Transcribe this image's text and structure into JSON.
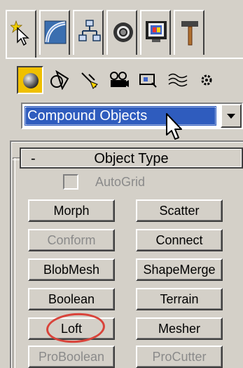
{
  "command_tabs": [
    {
      "icon": "create-star-cursor-icon",
      "active": true
    },
    {
      "icon": "modify-bend-icon",
      "active": false
    },
    {
      "icon": "hierarchy-icon",
      "active": false
    },
    {
      "icon": "motion-wheel-icon",
      "active": false
    },
    {
      "icon": "display-monitor-icon",
      "active": false
    },
    {
      "icon": "utilities-hammer-icon",
      "active": false
    }
  ],
  "categories": [
    {
      "icon": "geometry-sphere-icon",
      "active": true
    },
    {
      "icon": "shapes-icon",
      "active": false
    },
    {
      "icon": "lights-icon",
      "active": false
    },
    {
      "icon": "cameras-icon",
      "active": false
    },
    {
      "icon": "helpers-icon",
      "active": false
    },
    {
      "icon": "space-warps-icon",
      "active": false
    },
    {
      "icon": "systems-icon",
      "active": false
    }
  ],
  "dropdown": {
    "selected": "Compound Objects"
  },
  "rollout": {
    "toggle": "-",
    "title": "Object Type",
    "autogrid_label": "AutoGrid",
    "buttons": [
      {
        "label": "Morph",
        "enabled": true
      },
      {
        "label": "Scatter",
        "enabled": true
      },
      {
        "label": "Conform",
        "enabled": false
      },
      {
        "label": "Connect",
        "enabled": true
      },
      {
        "label": "BlobMesh",
        "enabled": true
      },
      {
        "label": "ShapeMerge",
        "enabled": true
      },
      {
        "label": "Boolean",
        "enabled": true
      },
      {
        "label": "Terrain",
        "enabled": true
      },
      {
        "label": "Loft",
        "enabled": true
      },
      {
        "label": "Mesher",
        "enabled": true
      },
      {
        "label": "ProBoolean",
        "enabled": false
      },
      {
        "label": "ProCutter",
        "enabled": false
      }
    ]
  },
  "colors": {
    "panel_bg": "#d4d0c8",
    "selection": "#2f5cbe",
    "active_category": "#f0c000",
    "highlight_ellipse": "#d9433a"
  }
}
